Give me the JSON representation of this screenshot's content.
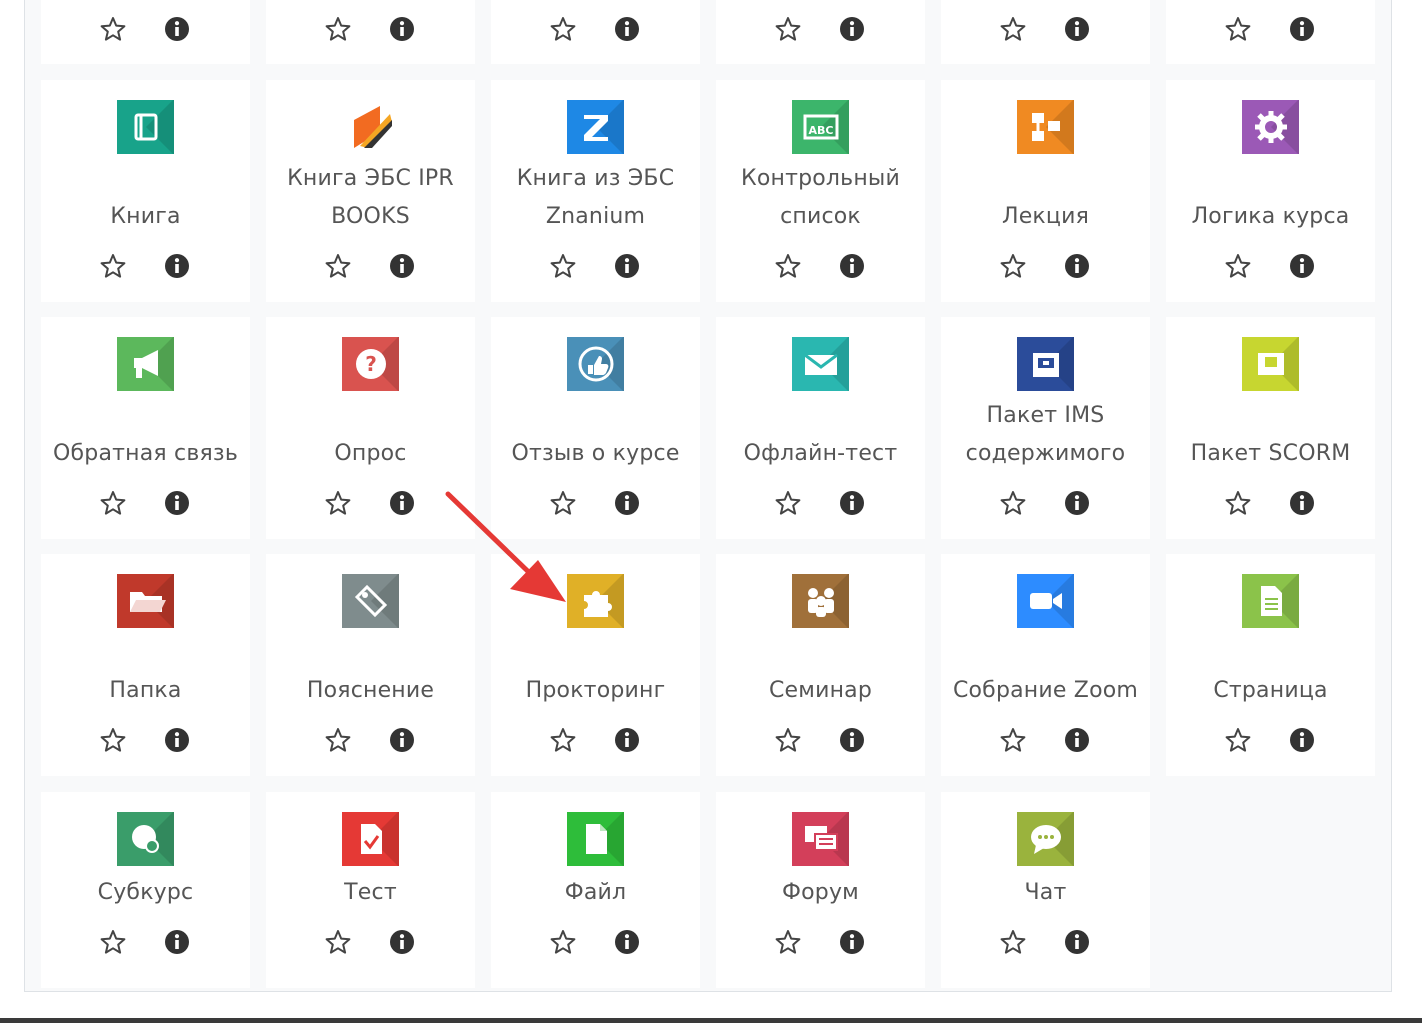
{
  "activity_chooser": {
    "top_row_count": 6,
    "tiles": [
      {
        "label": "Книга",
        "icon": "book-icon",
        "color": "#18a38a"
      },
      {
        "label": "Книга ЭБС IPR BOOKS",
        "icon": "iprbooks-logo-icon",
        "color": "#ffffff"
      },
      {
        "label": "Книга из ЭБС Znanium",
        "icon": "znanium-logo-icon",
        "color": "#1e88e5"
      },
      {
        "label": "Контрольный список",
        "icon": "checklist-abc-icon",
        "color": "#3cb56b"
      },
      {
        "label": "Лекция",
        "icon": "lesson-flowchart-icon",
        "color": "#f08a22"
      },
      {
        "label": "Логика курса",
        "icon": "gear-icon",
        "color": "#9b59b6"
      },
      {
        "label": "Обратная связь",
        "icon": "megaphone-icon",
        "color": "#5cb85c"
      },
      {
        "label": "Опрос",
        "icon": "question-icon",
        "color": "#d9534f"
      },
      {
        "label": "Отзыв о курсе",
        "icon": "thumbs-up-icon",
        "color": "#4a90b8"
      },
      {
        "label": "Офлайн-тест",
        "icon": "offline-quiz-icon",
        "color": "#2ab7b0"
      },
      {
        "label": "Пакет IMS содержимого",
        "icon": "ims-package-icon",
        "color": "#2b4c9a"
      },
      {
        "label": "Пакет SCORM",
        "icon": "scorm-package-icon",
        "color": "#c7d630"
      },
      {
        "label": "Папка",
        "icon": "folder-icon",
        "color": "#c0392b"
      },
      {
        "label": "Пояснение",
        "icon": "tag-icon",
        "color": "#7f8c8d"
      },
      {
        "label": "Прокторинг",
        "icon": "puzzle-icon",
        "color": "#e0b027"
      },
      {
        "label": "Семинар",
        "icon": "workshop-people-icon",
        "color": "#a0703a"
      },
      {
        "label": "Собрание Zoom",
        "icon": "zoom-camera-icon",
        "color": "#2d8cff"
      },
      {
        "label": "Страница",
        "icon": "page-icon",
        "color": "#8bc34a"
      },
      {
        "label": "Субкурс",
        "icon": "subcourse-icon",
        "color": "#3a9d6a"
      },
      {
        "label": "Тест",
        "icon": "quiz-check-icon",
        "color": "#e53935"
      },
      {
        "label": "Файл",
        "icon": "file-icon",
        "color": "#2ebd3a"
      },
      {
        "label": "Форум",
        "icon": "forum-icon",
        "color": "#d33f5a"
      },
      {
        "label": "Чат",
        "icon": "chat-icon",
        "color": "#9ab33d"
      }
    ]
  },
  "annotation": {
    "target": "Прокторинг",
    "color": "#e53935"
  }
}
